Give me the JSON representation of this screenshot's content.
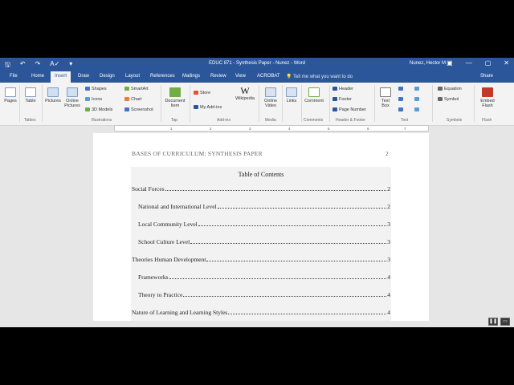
{
  "window": {
    "title": "EDUC 871 - Synthesis Paper - Nunez  -  Word",
    "user": "Nunez, Hector M",
    "qat": {
      "save": "🖫",
      "undo": "↶",
      "redo": "↷",
      "spell": "A✓",
      "more": "▾"
    },
    "controls": {
      "ribbon_options": "▣",
      "minimize": "—",
      "maximize": "▢",
      "close": "✕"
    }
  },
  "tabs": [
    {
      "label": "File",
      "active": false
    },
    {
      "label": "Home",
      "active": false
    },
    {
      "label": "Insert",
      "active": true
    },
    {
      "label": "Draw",
      "active": false
    },
    {
      "label": "Design",
      "active": false
    },
    {
      "label": "Layout",
      "active": false
    },
    {
      "label": "References",
      "active": false
    },
    {
      "label": "Mailings",
      "active": false
    },
    {
      "label": "Review",
      "active": false
    },
    {
      "label": "View",
      "active": false
    },
    {
      "label": "ACROBAT",
      "active": false
    }
  ],
  "tell_me": "Tell me what you want to do",
  "share": "Share",
  "ribbon": {
    "pages": "Pages",
    "table": "Table",
    "pictures": "Pictures",
    "online_pictures": "Online Pictures",
    "shapes": "Shapes",
    "icons": "Icons",
    "models_3d": "3D Models",
    "smartart": "SmartArt",
    "chart": "Chart",
    "screenshot": "Screenshot",
    "document_item": "Document Item",
    "store": "Store",
    "my_addins": "My Add-ins",
    "wikipedia": "Wikipedia",
    "wikipedia_glyph": "W",
    "online_video": "Online Video",
    "links": "Links",
    "comment": "Comment",
    "header": "Header",
    "footer": "Footer",
    "page_number": "Page Number",
    "text_box": "Text Box",
    "equation": "Equation",
    "symbol": "Symbol",
    "embed_flash": "Embed Flash",
    "groups": {
      "tables": "Tables",
      "illustrations": "Illustrations",
      "tap": "Tap",
      "addins": "Add-ins",
      "media": "Media",
      "comments": "Comments",
      "header_footer": "Header & Footer",
      "text": "Text",
      "symbols": "Symbols",
      "flash": "Flash"
    }
  },
  "ruler": [
    "1",
    "2",
    "3",
    "4",
    "5",
    "6",
    "7"
  ],
  "document": {
    "running_head": "BASES OF CURRICULUM: SYNTHESIS PAPER",
    "page_number": "2",
    "toc_title": "Table of Contents",
    "toc": [
      {
        "label": "Social Forces",
        "page": "2",
        "level": 1
      },
      {
        "label": "National and International Level",
        "page": "2",
        "level": 2
      },
      {
        "label": "Local Community Level",
        "page": "3",
        "level": 2
      },
      {
        "label": "School Culture Level",
        "page": "3",
        "level": 2
      },
      {
        "label": "Theories Human Development",
        "page": "3",
        "level": 1
      },
      {
        "label": "Frameworks",
        "page": "4",
        "level": 2
      },
      {
        "label": "Theory to Practice",
        "page": "4",
        "level": 2
      },
      {
        "label": "Nature of Learning and Learning Styles",
        "page": "4",
        "level": 1
      }
    ]
  },
  "video_controls": {
    "pip": "❚❚",
    "fullscreen": "▭"
  },
  "colors": {
    "accent": "#2b579a",
    "ribbon_bg": "#f3f3f3",
    "toc_bg": "#f2f2f2"
  }
}
